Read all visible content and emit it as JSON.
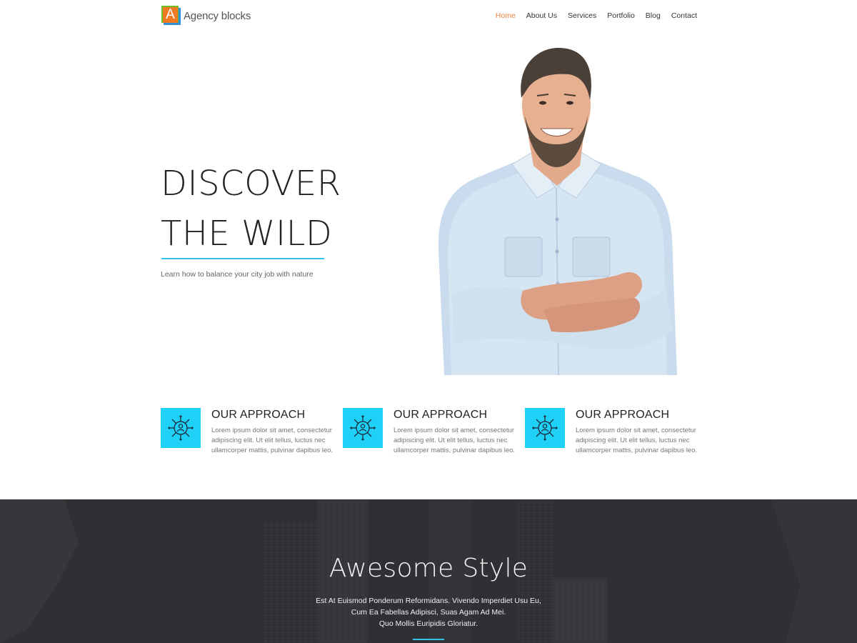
{
  "brand": {
    "logo_letter": "A",
    "name": "Agency blocks",
    "colors": {
      "orange": "#f07a24",
      "green": "#6fbf2d",
      "blue": "#2f8fd8"
    }
  },
  "nav": {
    "items": [
      "Home",
      "About Us",
      "Services",
      "Portfolio",
      "Blog",
      "Contact"
    ],
    "active": "Home",
    "active_color": "#e8833a"
  },
  "hero": {
    "title_line1": "DISCOVER",
    "title_line2": "THE WILD",
    "subtitle": "Learn how to balance your city job with nature",
    "accent_color": "#34c2e4",
    "image": "smiling-man-arms-crossed"
  },
  "features": [
    {
      "icon": "network-person-icon",
      "title": "OUR APPROACH",
      "text": "Lorem ipsum dolor sit amet, consectetur adipiscing elit. Ut elit tellus, luctus nec ullamcorper mattis, pulvinar dapibus leo."
    },
    {
      "icon": "network-person-icon",
      "title": "OUR APPROACH",
      "text": "Lorem ipsum dolor sit amet, consectetur adipiscing elit. Ut elit tellus, luctus nec ullamcorper mattis, pulvinar dapibus leo."
    },
    {
      "icon": "network-person-icon",
      "title": "OUR APPROACH",
      "text": "Lorem ipsum dolor sit amet, consectetur adipiscing elit. Ut elit tellus, luctus nec ullamcorper mattis, pulvinar dapibus leo."
    }
  ],
  "feature_icon_color": "#1fd0f7",
  "style_section": {
    "title": "Awesome Style",
    "text_lines": [
      "Est At Euismod Ponderum Reformidans. Vivendo Imperdiet Usu Eu,",
      "Cum Ea Fabellas Adipisci, Suas Agam Ad Mei.",
      "Quo Mollis Euripidis Gloriatur."
    ],
    "background_color": "#2f3033"
  }
}
